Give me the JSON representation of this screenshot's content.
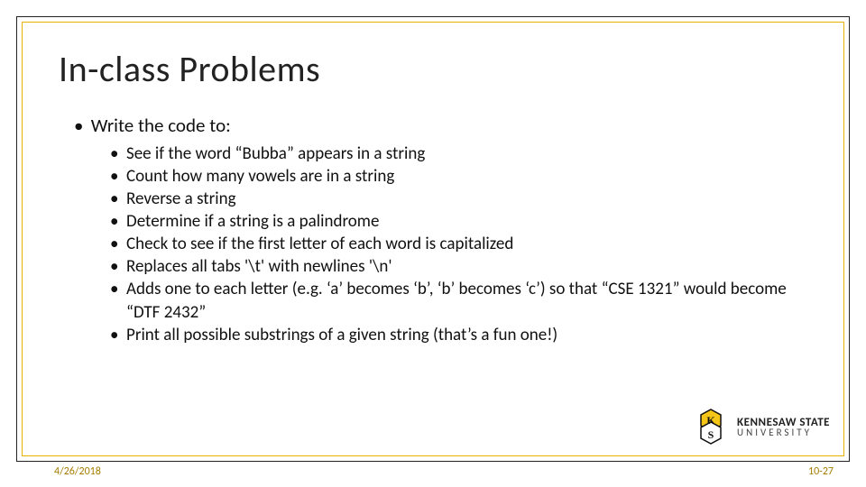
{
  "title": "In-class Problems",
  "main_bullet": "Write the code to:",
  "sub_bullets": [
    "See if the word “Bubba” appears in a string",
    "Count how many vowels are in a string",
    "Reverse a string",
    "Determine if a string is a palindrome",
    "Check to see if the first letter of each word is capitalized",
    "Replaces all tabs '\\t' with newlines '\\n'",
    "Adds one to each letter (e.g. ‘a’ becomes ‘b’, ‘b’ becomes ‘c’) so that “CSE 1321” would become “DTF 2432”",
    "Print all possible substrings of a given string (that’s a fun one!)"
  ],
  "footer_date": "4/26/2018",
  "footer_page": "10-27",
  "logo": {
    "line1": "KENNESAW STATE",
    "line2": "UNIVERSITY"
  }
}
